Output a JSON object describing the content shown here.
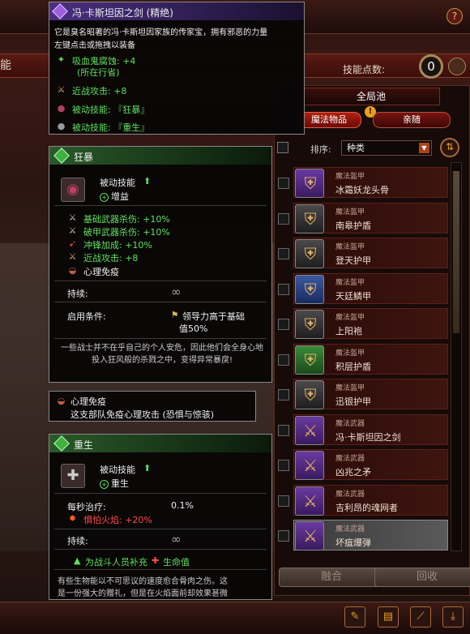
{
  "top": {
    "left_label": "能",
    "help_label": "?",
    "skill_points_label": "技能点数:",
    "skill_points": "0"
  },
  "pool": {
    "header": "全局池",
    "tab_magic": "魔法物品",
    "tab_followers": "亲随",
    "warn": "!"
  },
  "sort": {
    "label": "排序:",
    "value": "种类"
  },
  "items": [
    {
      "type": "魔法盔甲",
      "name": "冰霜妖龙头骨",
      "color": "purple"
    },
    {
      "type": "魔法盔甲",
      "name": "南皋护盾",
      "color": "gray"
    },
    {
      "type": "魔法盔甲",
      "name": "登天护甲",
      "color": "gray"
    },
    {
      "type": "魔法盔甲",
      "name": "天廷鳞甲",
      "color": "blue"
    },
    {
      "type": "魔法盔甲",
      "name": "上阳袍",
      "color": "gray"
    },
    {
      "type": "魔法盔甲",
      "name": "积层护盾",
      "color": "green"
    },
    {
      "type": "魔法盔甲",
      "name": "迅银护甲",
      "color": "gray"
    },
    {
      "type": "魔法武器",
      "name": "冯·卡斯坦因之剑",
      "color": "purple"
    },
    {
      "type": "魔法武器",
      "name": "凶兆之矛",
      "color": "purple"
    },
    {
      "type": "魔法武器",
      "name": "吉利昂的魂网者",
      "color": "purple"
    },
    {
      "type": "魔法武器",
      "name": "坏疽爆弹",
      "color": "purple"
    }
  ],
  "buttons": {
    "merge": "融合",
    "recycle": "回收"
  },
  "tooltip_item": {
    "title": "冯·卡斯坦因之剑 (精绝)",
    "desc": "它是臭名昭著的冯·卡斯坦因家族的传家宝，拥有邪恶的力量",
    "hint": "左键点击或拖拽以装备",
    "stats": [
      "吸血鬼腐蚀: +4",
      "(所在行省)",
      "近战攻击: +8",
      "被动技能: 『狂暴』",
      "被动技能: 『重生』"
    ]
  },
  "tooltip_frenzy": {
    "title": "狂暴",
    "kind": "被动技能",
    "effect": "增益",
    "stats": [
      "基础武器杀伤: +10%",
      "破甲武器杀伤: +10%",
      "冲锋加成: +10%",
      "近战攻击: +8",
      "心理免疫"
    ],
    "duration_label": "持续:",
    "duration_value": "∞",
    "cond_label": "启用条件:",
    "cond_value_1": "领导力高于基础",
    "cond_value_2": "值50%",
    "flavor": "一些战士并不在乎自己的个人安危，因此他们会全身心地投入狂风般的杀戮之中，变得异常暴戾!"
  },
  "tooltip_immune": {
    "title": "心理免疫",
    "desc": "这支部队免疫心理攻击 (恐惧与惊骇)"
  },
  "tooltip_regen": {
    "title": "重生",
    "kind": "被动技能",
    "effect": "重生",
    "heal_label": "每秒治疗:",
    "heal_value": "0.1%",
    "fire_label": "惧怕火焰: +20%",
    "duration_label": "持续:",
    "duration_value": "∞",
    "replenish_1": "为战斗人员补充",
    "replenish_2": "生命值",
    "flavor_1": "有些生物能以不可思议的速度愈合骨肉之伤。这",
    "flavor_2": "是一份强大的赠礼，但是在火焰面前却效果甚微"
  }
}
